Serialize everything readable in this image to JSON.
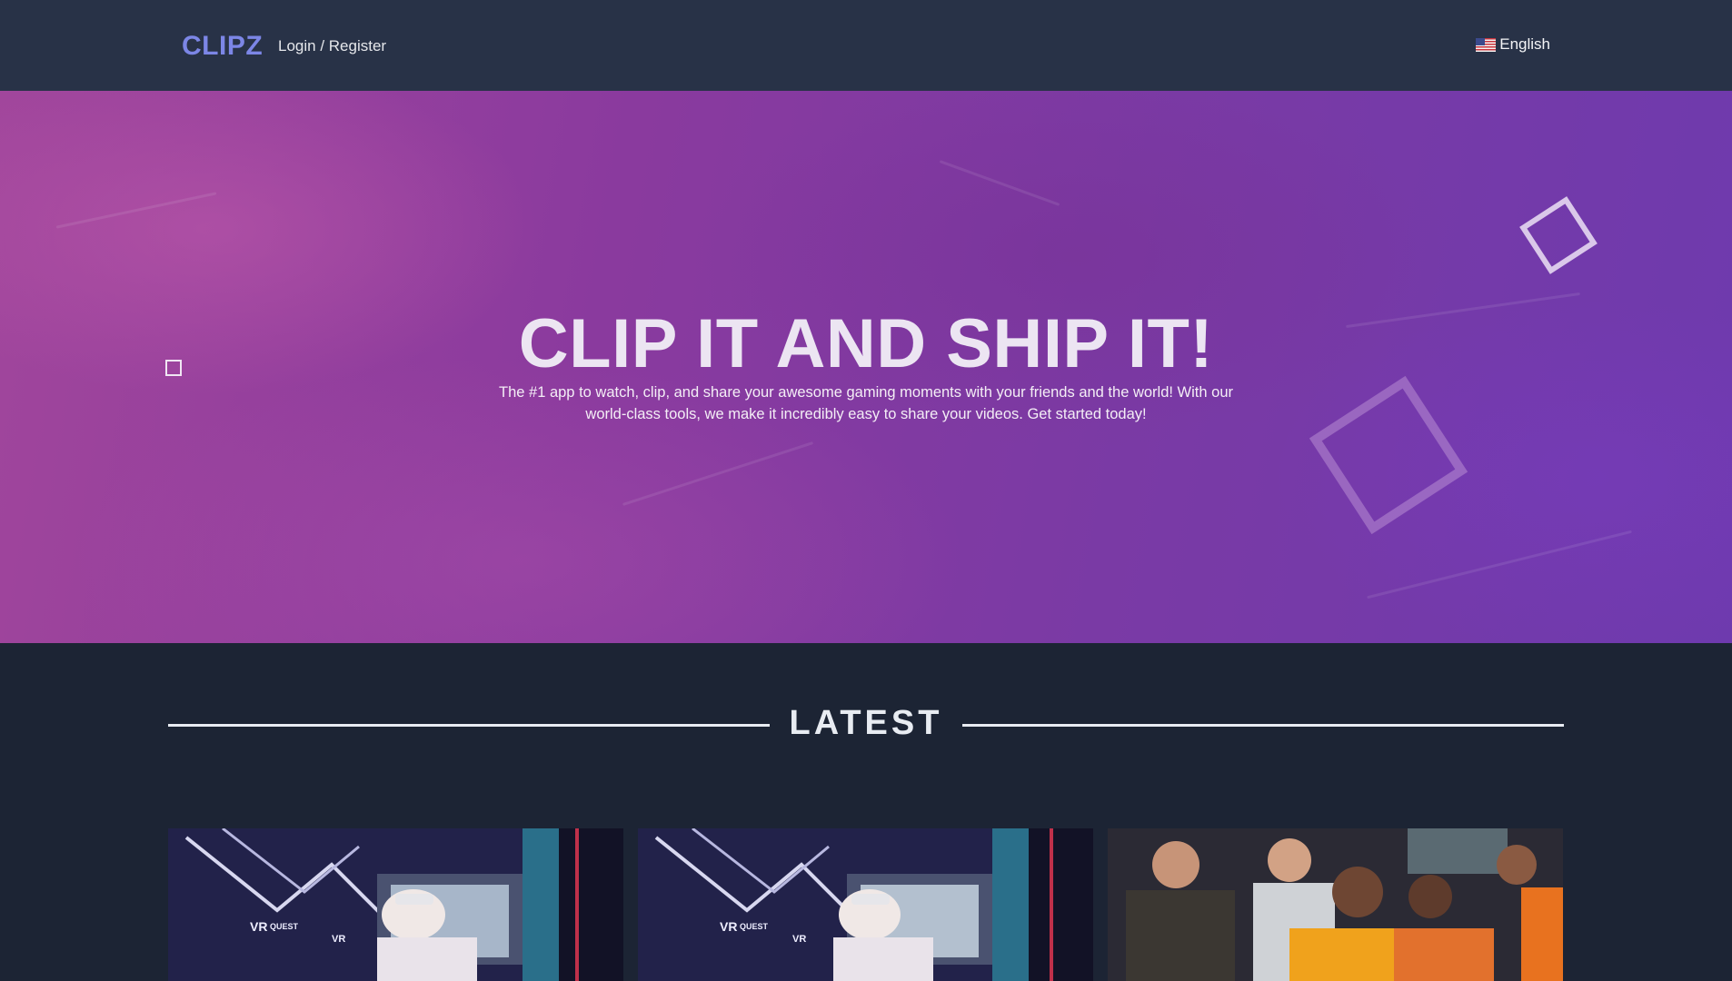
{
  "nav": {
    "brand": "CLIPZ",
    "login_label": "Login / Register",
    "language": "English",
    "language_flag_icon": "us-flag-icon"
  },
  "hero": {
    "title": "CLIP IT AND SHIP IT!",
    "description": "The #1 app to watch, clip, and share your awesome gaming moments with your friends and the world! With our world-class tools, we make it incredibly easy to share your videos. Get started today!"
  },
  "latest": {
    "title": "LATEST"
  },
  "cards": [
    {
      "thumb_label_1": "VR",
      "thumb_label_2": "QUEST",
      "thumb_label_3": "VR"
    },
    {
      "thumb_label_1": "VR",
      "thumb_label_2": "QUEST",
      "thumb_label_3": "VR"
    },
    {}
  ],
  "colors": {
    "nav_bg": "#283247",
    "page_bg": "#1c2434",
    "brand": "#7c86e6",
    "hero_purple": "#8a3a9e"
  }
}
